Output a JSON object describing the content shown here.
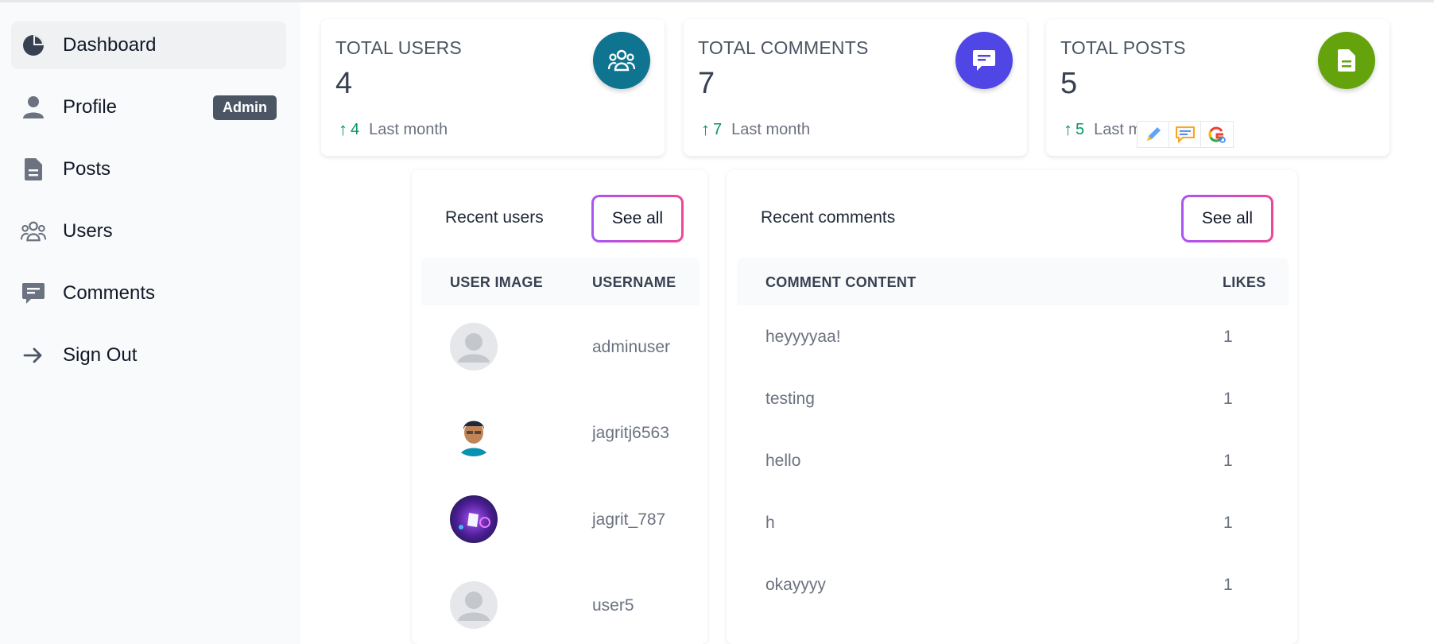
{
  "sidebar": {
    "items": [
      {
        "label": "Dashboard",
        "icon": "pie-chart-icon",
        "active": true
      },
      {
        "label": "Profile",
        "icon": "user-icon",
        "badge": "Admin"
      },
      {
        "label": "Posts",
        "icon": "document-icon"
      },
      {
        "label": "Users",
        "icon": "users-group-icon"
      },
      {
        "label": "Comments",
        "icon": "comment-icon"
      },
      {
        "label": "Sign Out",
        "icon": "arrow-right-icon"
      }
    ]
  },
  "stats": [
    {
      "title": "TOTAL USERS",
      "value": "4",
      "trend": "4",
      "trend_text": "Last month",
      "icon": "users-group-icon",
      "color": "#0e7490"
    },
    {
      "title": "TOTAL COMMENTS",
      "value": "7",
      "trend": "7",
      "trend_text": "Last month",
      "icon": "comment-icon",
      "color": "#4f46e5"
    },
    {
      "title": "TOTAL POSTS",
      "value": "5",
      "trend": "5",
      "trend_text": "Last m",
      "icon": "document-icon",
      "color": "#65a30d"
    }
  ],
  "trend_arrow": "↑",
  "recent_users": {
    "title": "Recent users",
    "see_all": "See all",
    "columns": [
      "USER IMAGE",
      "USERNAME"
    ],
    "rows": [
      {
        "username": "adminuser",
        "avatar": "default-avatar"
      },
      {
        "username": "jagritj6563",
        "avatar": "photo-avatar"
      },
      {
        "username": "jagrit_787",
        "avatar": "purple-avatar"
      },
      {
        "username": "user5",
        "avatar": "default-avatar"
      }
    ]
  },
  "recent_comments": {
    "title": "Recent comments",
    "see_all": "See all",
    "columns": [
      "COMMENT CONTENT",
      "LIKES"
    ],
    "rows": [
      {
        "content": "heyyyyaa!",
        "likes": "1"
      },
      {
        "content": "testing",
        "likes": "1"
      },
      {
        "content": "hello",
        "likes": "1"
      },
      {
        "content": "h",
        "likes": "1"
      },
      {
        "content": "okayyyy",
        "likes": "1"
      }
    ]
  },
  "extension_toolbar": [
    "pencil-icon",
    "speech-bubble-icon",
    "google-search-icon"
  ]
}
